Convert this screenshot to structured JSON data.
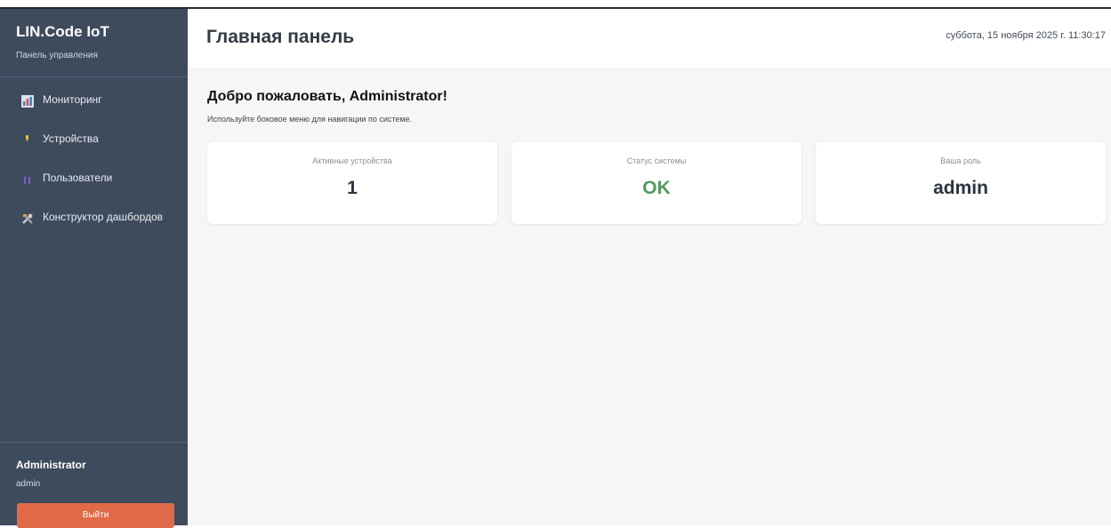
{
  "sidebar": {
    "brand_title": "LIN.Code IoT",
    "brand_subtitle": "Панель управления",
    "items": [
      {
        "label": "Мониторинг",
        "icon": "chart-icon"
      },
      {
        "label": "Устройства",
        "icon": "device-icon"
      },
      {
        "label": "Пользователи",
        "icon": "users-icon"
      },
      {
        "label": "Конструктор дашбордов",
        "icon": "tools-icon"
      }
    ],
    "user": {
      "name": "Administrator",
      "role": "admin",
      "logout_label": "Выйти"
    }
  },
  "header": {
    "title": "Главная панель",
    "datetime": "суббота, 15 ноября 2025 г. 11:30:17"
  },
  "main": {
    "welcome": "Добро пожаловать, Administrator!",
    "hint": "Используйте боковое меню для навигации по системе.",
    "cards": [
      {
        "label": "Активные устройства",
        "value": "1"
      },
      {
        "label": "Статус системы",
        "value": "OK"
      },
      {
        "label": "Ваша роль",
        "value": "admin"
      }
    ]
  },
  "colors": {
    "sidebar_bg": "#3e4b5d",
    "logout_button": "#e06a48",
    "status_ok": "#4f9a5e",
    "main_bg": "#f4f6f8"
  }
}
